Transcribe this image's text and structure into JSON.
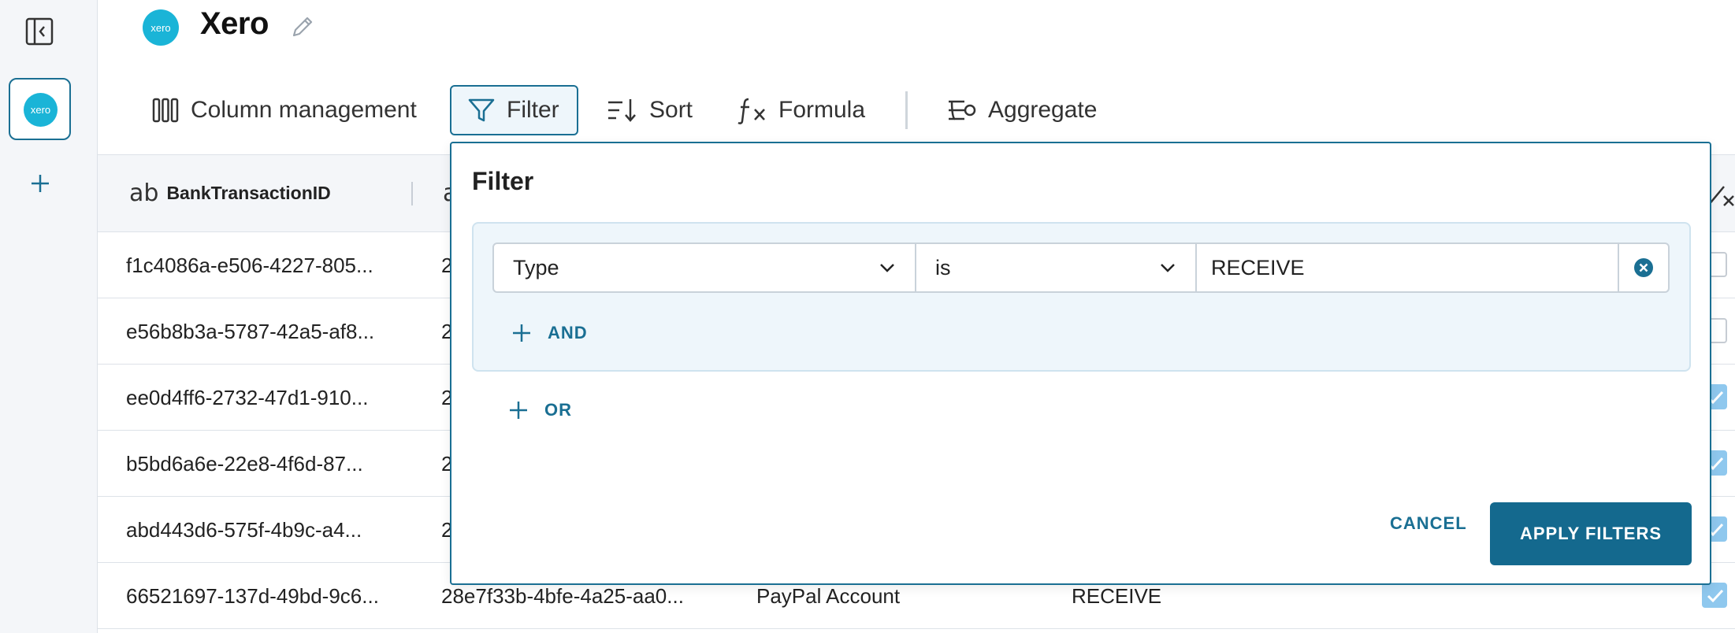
{
  "app": {
    "title": "Xero",
    "logo_text": "xero",
    "brand_color": "#1ab4d7",
    "accent_color": "#1a6f93"
  },
  "rail": {
    "collapse_icon": "sidebar-collapse-icon",
    "source_logo_text": "xero",
    "add_icon": "plus-icon"
  },
  "toolbar": {
    "column_management": "Column management",
    "filter": "Filter",
    "sort": "Sort",
    "formula": "Formula",
    "aggregate": "Aggregate"
  },
  "table": {
    "columns": [
      {
        "type_icon": "ab",
        "label": "BankTransactionID"
      },
      {
        "type_icon": "a",
        "label": ""
      }
    ],
    "rows": [
      {
        "c1": "f1c4086a-e506-4227-805...",
        "c2": "2",
        "c3": "",
        "c4": "",
        "checked": false
      },
      {
        "c1": "e56b8b3a-5787-42a5-af8...",
        "c2": "2",
        "c3": "",
        "c4": "",
        "checked": false
      },
      {
        "c1": "ee0d4ff6-2732-47d1-910...",
        "c2": "2",
        "c3": "",
        "c4": "",
        "checked": true
      },
      {
        "c1": "b5bd6a6e-22e8-4f6d-87...",
        "c2": "2",
        "c3": "",
        "c4": "",
        "checked": true
      },
      {
        "c1": "abd443d6-575f-4b9c-a4...",
        "c2": "2",
        "c3": "",
        "c4": "",
        "checked": true
      },
      {
        "c1": "66521697-137d-49bd-9c6...",
        "c2": "28e7f33b-4bfe-4a25-aa0...",
        "c3": "PayPal Account",
        "c4": "RECEIVE",
        "checked": true
      }
    ]
  },
  "filter_panel": {
    "title": "Filter",
    "condition": {
      "field": "Type",
      "operator": "is",
      "value": "RECEIVE"
    },
    "and_label": "AND",
    "or_label": "OR",
    "cancel_label": "CANCEL",
    "apply_label": "APPLY FILTERS"
  }
}
